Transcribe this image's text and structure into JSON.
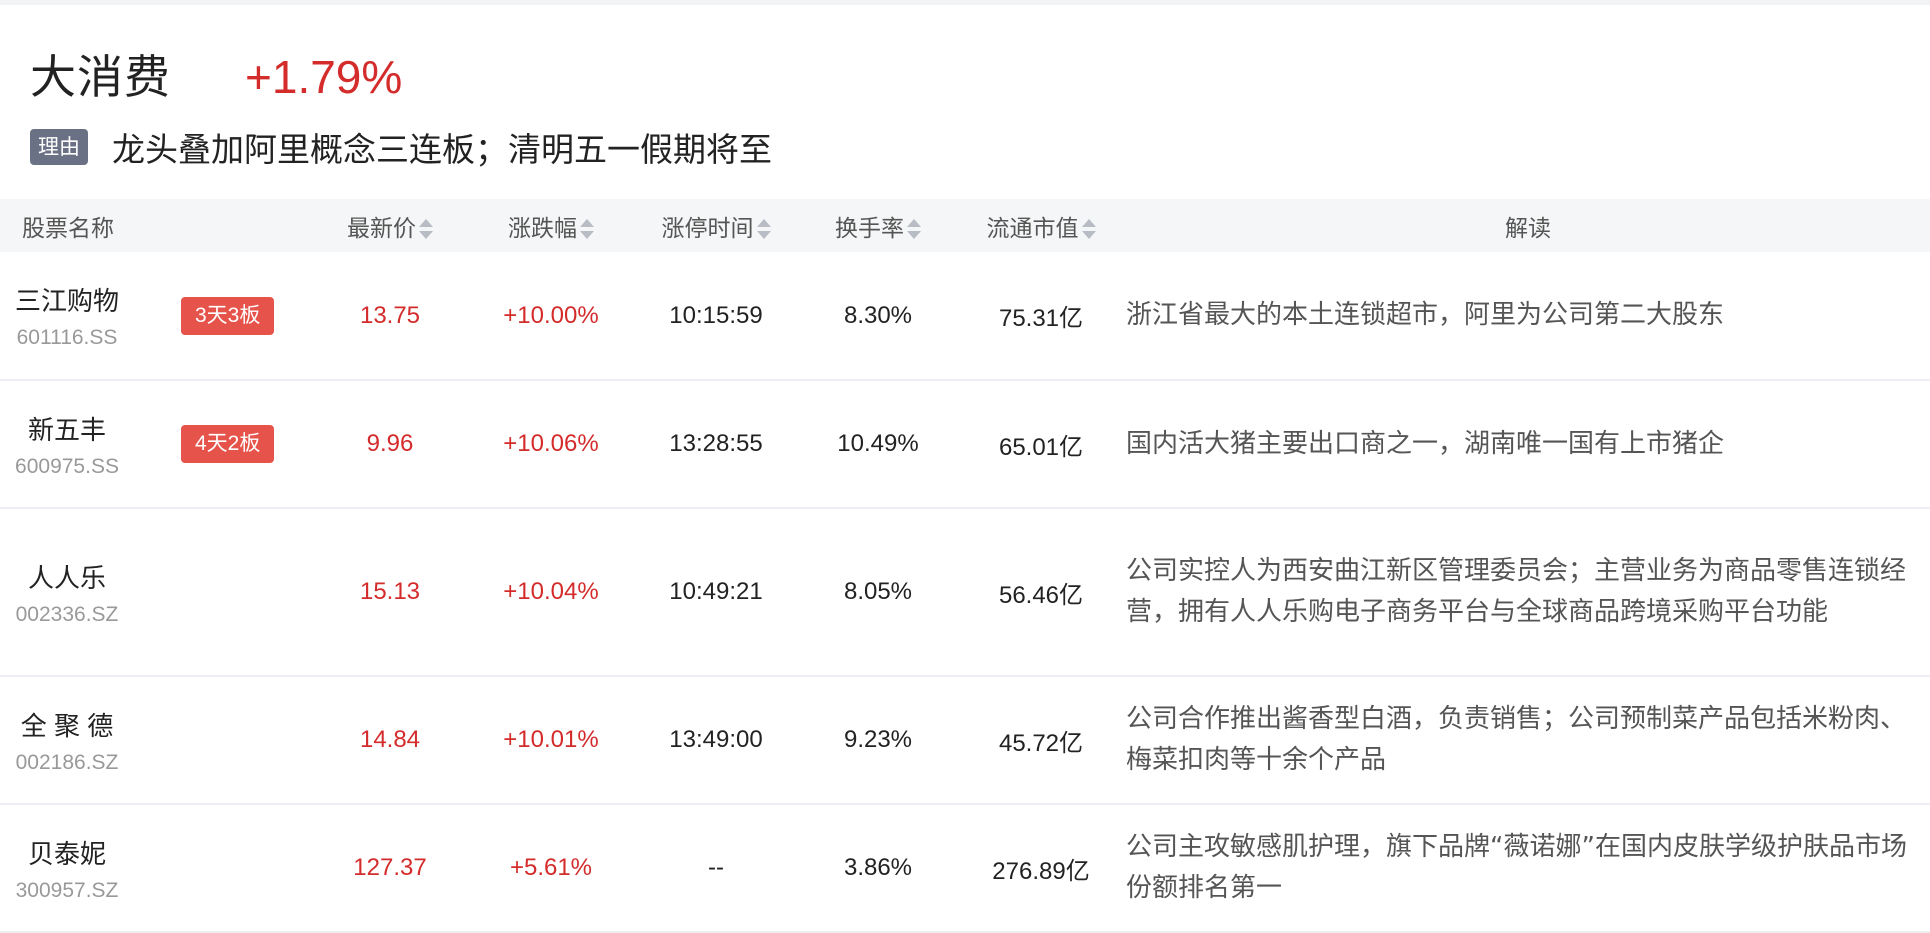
{
  "board": {
    "name": "大消费",
    "change": "+1.79%",
    "reason_tag": "理由",
    "reason_text": "龙头叠加阿里概念三连板；清明五一假期将至"
  },
  "colors": {
    "rise": "#d42b2b",
    "badge": "#e6534b",
    "tag": "#6b7184"
  },
  "columns": {
    "name": "股票名称",
    "price": "最新价",
    "change": "涨跌幅",
    "limit_time": "涨停时间",
    "turnover": "换手率",
    "float_cap": "流通市值",
    "reading": "解读"
  },
  "rows": [
    {
      "name": "三江购物",
      "code": "601116.SS",
      "badge": "3天3板",
      "price": "13.75",
      "change": "+10.00%",
      "limit_time": "10:15:59",
      "turnover": "8.30%",
      "float_cap": "75.31亿",
      "reading": "浙江省最大的本土连锁超市，阿里为公司第二大股东"
    },
    {
      "name": "新五丰",
      "code": "600975.SS",
      "badge": "4天2板",
      "price": "9.96",
      "change": "+10.06%",
      "limit_time": "13:28:55",
      "turnover": "10.49%",
      "float_cap": "65.01亿",
      "reading": "国内活大猪主要出口商之一，湖南唯一国有上市猪企"
    },
    {
      "name": "人人乐",
      "code": "002336.SZ",
      "badge": "",
      "price": "15.13",
      "change": "+10.04%",
      "limit_time": "10:49:21",
      "turnover": "8.05%",
      "float_cap": "56.46亿",
      "reading": "公司实控人为西安曲江新区管理委员会；主营业务为商品零售连锁经营，拥有人人乐购电子商务平台与全球商品跨境采购平台功能"
    },
    {
      "name": "全 聚 德",
      "code": "002186.SZ",
      "badge": "",
      "price": "14.84",
      "change": "+10.01%",
      "limit_time": "13:49:00",
      "turnover": "9.23%",
      "float_cap": "45.72亿",
      "reading": "公司合作推出酱香型白酒，负责销售；公司预制菜产品包括米粉肉、梅菜扣肉等十余个产品"
    },
    {
      "name": "贝泰妮",
      "code": "300957.SZ",
      "badge": "",
      "price": "127.37",
      "change": "+5.61%",
      "limit_time": "--",
      "turnover": "3.86%",
      "float_cap": "276.89亿",
      "reading": "公司主攻敏感肌护理，旗下品牌“薇诺娜”在国内皮肤学级护肤品市场份额排名第一"
    }
  ]
}
